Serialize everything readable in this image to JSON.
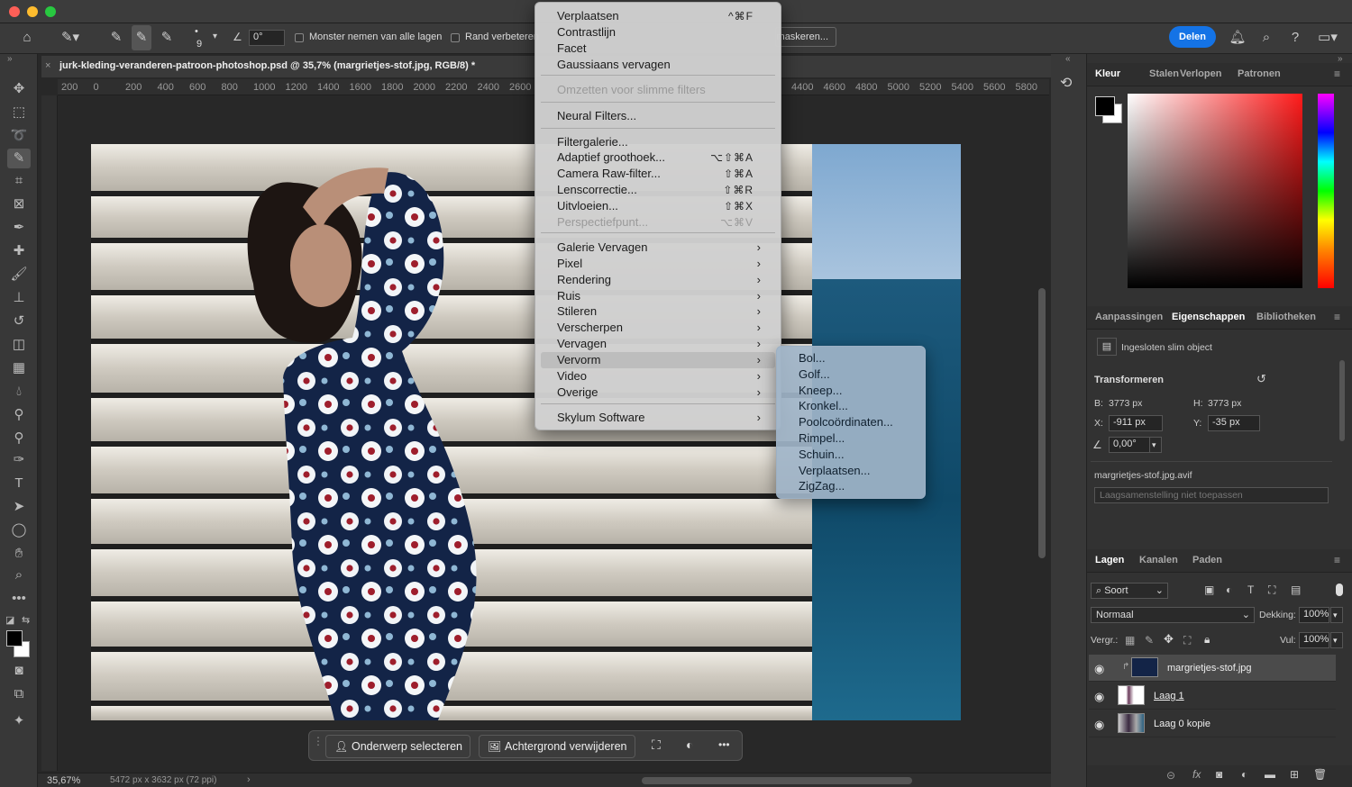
{
  "options": {
    "brush_size": "9",
    "angle_value": "0°",
    "sample_all_layers": "Monster nemen van alle lagen",
    "enhance_edge": "Rand verbeteren",
    "mask_button_tail": "maskeren...",
    "share_button": "Delen"
  },
  "document": {
    "tab_title": "jurk-kleding-veranderen-patroon-photoshop.psd @ 35,7% (margrietjes-stof.jpg, RGB/8) *",
    "ruler_ticks": [
      "200",
      "0",
      "200",
      "400",
      "600",
      "800",
      "1000",
      "1200",
      "1400",
      "1600",
      "1800",
      "2000",
      "2200",
      "2400",
      "2600"
    ],
    "ruler_ticks_right": [
      "4400",
      "4600",
      "4800",
      "5000",
      "5200",
      "5400",
      "5600",
      "5800"
    ],
    "zoom": "35,67%",
    "doc_info": "5472 px x 3632 px (72 ppi)"
  },
  "context_bar": {
    "select_subject": "Onderwerp selecteren",
    "remove_background": "Achtergrond verwijderen",
    "more": "•••"
  },
  "filter_menu": {
    "items": [
      {
        "label": "Verplaatsen",
        "shortcut": "^⌘F"
      },
      {
        "label": "Contrastlijn"
      },
      {
        "label": "Facet"
      },
      {
        "label": "Gaussiaans vervagen"
      },
      {
        "label": "Omzetten voor slimme filters",
        "disabled": true
      },
      {
        "label": "Neural Filters..."
      },
      {
        "label": "Filtergalerie..."
      },
      {
        "label": "Adaptief groothoek...",
        "shortcut": "⌥⇧⌘A"
      },
      {
        "label": "Camera Raw-filter...",
        "shortcut": "⇧⌘A"
      },
      {
        "label": "Lenscorrectie...",
        "shortcut": "⇧⌘R"
      },
      {
        "label": "Uitvloeien...",
        "shortcut": "⇧⌘X"
      },
      {
        "label": "Perspectiefpunt...",
        "shortcut": "⌥⌘V",
        "disabled": true
      },
      {
        "label": "Galerie Vervagen"
      },
      {
        "label": "Pixel"
      },
      {
        "label": "Rendering"
      },
      {
        "label": "Ruis"
      },
      {
        "label": "Stileren"
      },
      {
        "label": "Verscherpen"
      },
      {
        "label": "Vervagen"
      },
      {
        "label": "Vervorm",
        "selected": true
      },
      {
        "label": "Video"
      },
      {
        "label": "Overige"
      },
      {
        "label": "Skylum Software"
      }
    ]
  },
  "distort_submenu": {
    "items": [
      "Bol...",
      "Golf...",
      "Kneep...",
      "Kronkel...",
      "Poolcoördinaten...",
      "Rimpel...",
      "Schuin...",
      "Verplaatsen...",
      "ZigZag..."
    ]
  },
  "color_panel": {
    "tabs": [
      "Kleur",
      "Stalen",
      "Verlopen",
      "Patronen"
    ],
    "active_tab": "Kleur",
    "hue_color": "#ff1a1a"
  },
  "properties_panel": {
    "tabs": [
      "Aanpassingen",
      "Eigenschappen",
      "Bibliotheken"
    ],
    "active_tab": "Eigenschappen",
    "object_type": "Ingesloten slim object",
    "section": "Transformeren",
    "w_label": "B:",
    "w_value": "3773 px",
    "h_label": "H:",
    "h_value": "3773 px",
    "x_label": "X:",
    "x_value": "-911 px",
    "y_label": "Y:",
    "y_value": "-35 px",
    "angle": "0,00°",
    "file": "margrietjes-stof.jpg.avif",
    "comp": "Laagsamenstelling niet toepassen"
  },
  "layers_panel": {
    "tabs": [
      "Lagen",
      "Kanalen",
      "Paden"
    ],
    "active_tab": "Lagen",
    "filter": "Soort",
    "blend": "Normaal",
    "opacity_label": "Dekking:",
    "opacity": "100%",
    "lock_label": "Vergr.:",
    "fill_label": "Vul:",
    "fill": "100%",
    "layers": [
      {
        "name": "margrietjes-stof.jpg",
        "selected": true
      },
      {
        "name": "Laag 1"
      },
      {
        "name": "Laag 0 kopie"
      }
    ],
    "footer_icons": [
      "link-icon",
      "fx-icon",
      "mask-icon",
      "adjustment-icon",
      "folder-icon",
      "new-layer-icon",
      "trash-icon"
    ]
  },
  "colors": {
    "accent": "#1473e6",
    "dress": "#132447",
    "sea": "#124a6b"
  }
}
